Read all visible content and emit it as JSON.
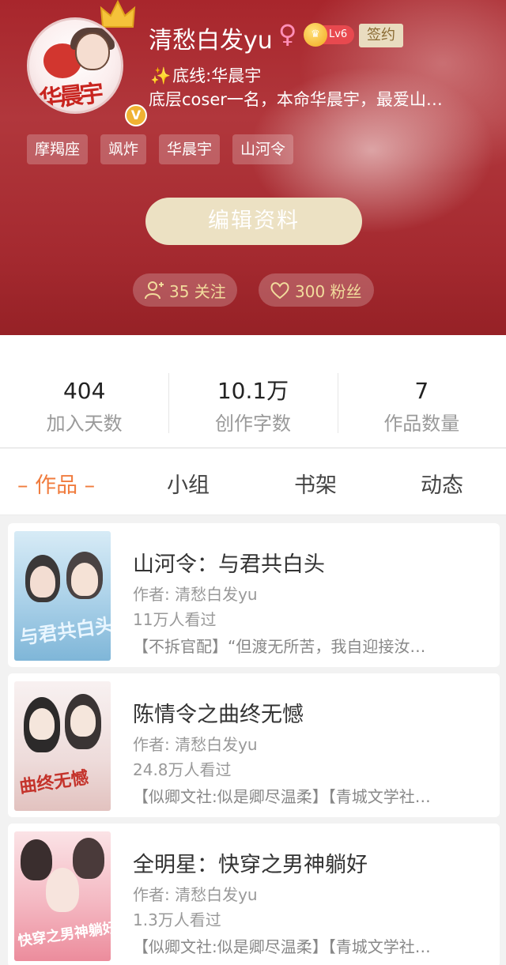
{
  "profile": {
    "name": "清愁白发yu",
    "gender_icon": "female-icon",
    "level": "Lv6",
    "sign_badge": "签约",
    "tagline": "底线:华晨宇",
    "bio": "底层coser一名，本命华晨宇，最爱山…",
    "avatar_text": "华晨宇",
    "verified": "V",
    "tags": [
      "摩羯座",
      "飒炸",
      "华晨宇",
      "山河令"
    ],
    "edit_button": "编辑资料",
    "following": "35 关注",
    "fans": "300 粉丝"
  },
  "stats": [
    {
      "value": "404",
      "label": "加入天数"
    },
    {
      "value": "10.1万",
      "label": "创作字数"
    },
    {
      "value": "7",
      "label": "作品数量"
    }
  ],
  "tabs": [
    {
      "label": "– 作品 –",
      "active": true
    },
    {
      "label": "小组",
      "active": false
    },
    {
      "label": "书架",
      "active": false
    },
    {
      "label": "动态",
      "active": false
    }
  ],
  "books": [
    {
      "title": "山河令：与君共白头",
      "author": "作者: 清愁白发yu",
      "views": "11万人看过",
      "desc": "【不拆官配】“但渡无所苦，我自迎接汝…",
      "cover_text": "与君共白头",
      "cover_colors": [
        "#bcdcef",
        "#7fb6d8"
      ]
    },
    {
      "title": "陈情令之曲终无憾",
      "author": "作者: 清愁白发yu",
      "views": "24.8万人看过",
      "desc": "【似卿文社:似是卿尽温柔】【青城文学社…",
      "cover_text": "曲终无憾",
      "cover_colors": [
        "#f4eaea",
        "#e7c9c6"
      ]
    },
    {
      "title": "全明星：快穿之男神躺好",
      "author": "作者: 清愁白发yu",
      "views": "1.3万人看过",
      "desc": "【似卿文社:似是卿尽温柔】【青城文学社…",
      "cover_text": "快穿之男神躺好",
      "cover_colors": [
        "#f7d9de",
        "#ec8c9c"
      ]
    }
  ],
  "colors": {
    "accent": "#f07c3e",
    "header_red": "#a8262c",
    "edit_button_bg": "#ece1c3",
    "follow_text": "#f2dc9c"
  }
}
